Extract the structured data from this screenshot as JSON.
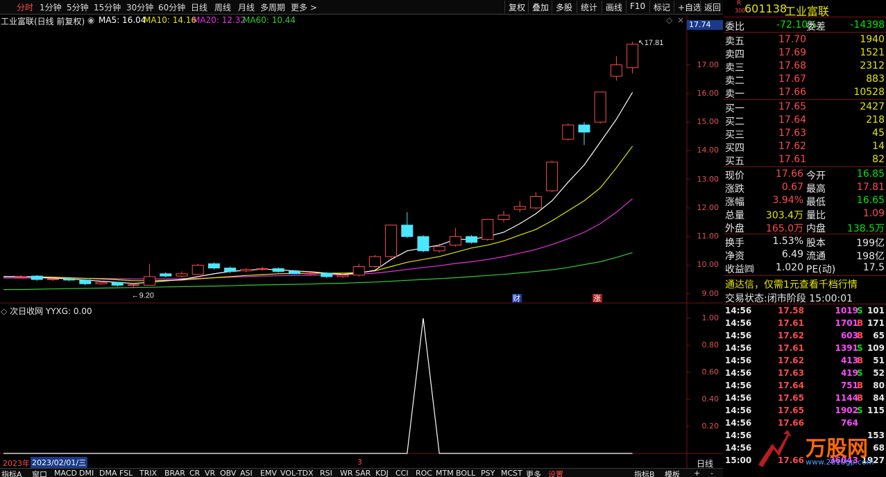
{
  "toolbar": {
    "periods": [
      "分时",
      "1分钟",
      "5分钟",
      "15分钟",
      "30分钟",
      "60分钟",
      "日线",
      "周线",
      "月线",
      "多周期",
      "更多 >"
    ],
    "active_period": "分时",
    "buttons": [
      "复权",
      "叠加",
      "多股",
      "统计",
      "画线",
      "F10",
      "标记",
      "+自选",
      "返回"
    ]
  },
  "chart_header": {
    "name": "工业富联(日线 前复权)",
    "ma5": "MA5: 16.04",
    "ma10": "MA10: 14.16",
    "ma20": "MA20: 12.32",
    "ma60": "MA60: 10.44"
  },
  "colors": {
    "up": "#ff4b4b",
    "down": "#4be6ff",
    "ma5": "#ffffff",
    "ma10": "#e6e600",
    "ma20": "#e633e6",
    "ma60": "#33cc33",
    "grid": "#7a1010"
  },
  "price_axis": {
    "current": "17.74",
    "ticks": [
      "17.00",
      "16.00",
      "15.00",
      "14.00",
      "13.00",
      "12.00",
      "11.00",
      "10.00",
      "9.00"
    ]
  },
  "chart_data": {
    "type": "candlestick",
    "ylim": [
      8.8,
      18.2
    ],
    "high_label": "17.81",
    "low_label": "9.20",
    "candles": [
      [
        9.58,
        9.6,
        9.65,
        9.55
      ],
      [
        9.62,
        9.5,
        9.65,
        9.45
      ],
      [
        9.5,
        9.52,
        9.55,
        9.45
      ],
      [
        9.52,
        9.48,
        9.56,
        9.44
      ],
      [
        9.48,
        9.35,
        9.5,
        9.3
      ],
      [
        9.35,
        9.4,
        9.45,
        9.32
      ],
      [
        9.4,
        9.3,
        9.42,
        9.25
      ],
      [
        9.3,
        9.32,
        9.36,
        9.2
      ],
      [
        9.3,
        9.6,
        10.05,
        9.3
      ],
      [
        9.7,
        9.62,
        9.75,
        9.58
      ],
      [
        9.62,
        9.7,
        9.78,
        9.58
      ],
      [
        9.68,
        10.0,
        10.05,
        9.66
      ],
      [
        10.05,
        9.9,
        10.1,
        9.85
      ],
      [
        9.9,
        9.78,
        9.95,
        9.72
      ],
      [
        9.8,
        9.85,
        9.9,
        9.75
      ],
      [
        9.86,
        9.88,
        9.95,
        9.8
      ],
      [
        9.88,
        9.78,
        9.92,
        9.74
      ],
      [
        9.78,
        9.7,
        9.82,
        9.68
      ],
      [
        9.7,
        9.72,
        9.75,
        9.66
      ],
      [
        9.72,
        9.6,
        9.75,
        9.55
      ],
      [
        9.6,
        9.65,
        9.7,
        9.56
      ],
      [
        9.65,
        9.95,
        10.05,
        9.6
      ],
      [
        9.95,
        10.3,
        10.35,
        9.9
      ],
      [
        10.3,
        11.4,
        11.4,
        10.25
      ],
      [
        11.4,
        11.0,
        11.85,
        10.95
      ],
      [
        11.0,
        10.5,
        11.05,
        10.45
      ],
      [
        10.5,
        10.65,
        10.75,
        10.45
      ],
      [
        10.7,
        11.0,
        11.3,
        10.65
      ],
      [
        11.0,
        10.8,
        11.05,
        10.75
      ],
      [
        10.9,
        11.6,
        11.6,
        10.85
      ],
      [
        11.6,
        11.75,
        11.9,
        11.5
      ],
      [
        11.95,
        12.05,
        12.25,
        11.85
      ],
      [
        12.0,
        12.4,
        12.55,
        11.95
      ],
      [
        12.6,
        13.6,
        13.65,
        12.55
      ],
      [
        14.4,
        14.9,
        14.95,
        14.35
      ],
      [
        14.9,
        14.65,
        15.0,
        14.2
      ],
      [
        15.0,
        16.05,
        16.05,
        14.95
      ],
      [
        16.6,
        17.0,
        17.3,
        16.45
      ],
      [
        16.9,
        17.72,
        17.81,
        16.7
      ]
    ],
    "ma5": [
      9.6,
      9.58,
      9.55,
      9.52,
      9.48,
      9.44,
      9.4,
      9.36,
      9.4,
      9.45,
      9.5,
      9.6,
      9.7,
      9.78,
      9.82,
      9.86,
      9.84,
      9.8,
      9.77,
      9.72,
      9.68,
      9.72,
      9.82,
      10.2,
      10.5,
      10.6,
      10.7,
      10.9,
      10.9,
      11.0,
      11.15,
      11.45,
      11.8,
      12.25,
      12.9,
      13.5,
      14.3,
      15.1,
      16.04
    ],
    "ma10": [
      9.6,
      9.59,
      9.58,
      9.56,
      9.54,
      9.52,
      9.49,
      9.46,
      9.46,
      9.47,
      9.48,
      9.52,
      9.56,
      9.6,
      9.64,
      9.67,
      9.7,
      9.71,
      9.72,
      9.72,
      9.72,
      9.74,
      9.8,
      9.95,
      10.1,
      10.2,
      10.3,
      10.45,
      10.6,
      10.7,
      10.85,
      11.05,
      11.25,
      11.55,
      11.9,
      12.25,
      12.7,
      13.4,
      14.16
    ],
    "ma20": [
      9.55,
      9.55,
      9.55,
      9.55,
      9.54,
      9.54,
      9.53,
      9.52,
      9.52,
      9.52,
      9.53,
      9.54,
      9.56,
      9.58,
      9.6,
      9.62,
      9.63,
      9.64,
      9.65,
      9.66,
      9.67,
      9.69,
      9.72,
      9.78,
      9.85,
      9.92,
      9.98,
      10.06,
      10.12,
      10.2,
      10.3,
      10.42,
      10.55,
      10.72,
      10.92,
      11.15,
      11.45,
      11.85,
      12.32
    ],
    "ma60": [
      9.15,
      9.16,
      9.17,
      9.18,
      9.19,
      9.2,
      9.21,
      9.22,
      9.23,
      9.24,
      9.25,
      9.26,
      9.27,
      9.28,
      9.3,
      9.31,
      9.32,
      9.33,
      9.34,
      9.36,
      9.37,
      9.39,
      9.41,
      9.44,
      9.47,
      9.5,
      9.53,
      9.56,
      9.6,
      9.64,
      9.68,
      9.73,
      9.78,
      9.84,
      9.92,
      10.02,
      10.12,
      10.27,
      10.44
    ],
    "markers": [
      "财",
      "涨"
    ]
  },
  "indicator": {
    "header": "次日收网  YYXG: 0.00",
    "ticks": [
      "1.00",
      "0.80",
      "0.60",
      "0.40",
      "0.20"
    ],
    "ylim": [
      0,
      1
    ],
    "values": [
      0,
      0,
      0,
      0,
      0,
      0,
      0,
      0,
      0,
      0,
      0,
      0,
      0,
      0,
      0,
      0,
      0,
      0,
      0,
      0,
      0,
      0,
      0,
      0,
      0,
      1,
      0,
      0,
      0,
      0,
      0,
      0,
      0,
      0,
      0,
      0,
      0,
      0,
      0
    ],
    "axis_year": "2023年",
    "axis_date": "2023/02/01/三",
    "axis_month": "3"
  },
  "bottom_tabs": [
    "指标A",
    "窗口",
    "MACD",
    "DMI",
    "DMA",
    "FSL",
    "TRIX",
    "BRAR",
    "CR",
    "VR",
    "OBV",
    "ASI",
    "EMV",
    "VOL-TDX",
    "RSI",
    "WR",
    "SAR",
    "KDJ",
    "CCI",
    "ROC",
    "MTM",
    "BOLL",
    "PSY",
    "MCST",
    "更多",
    "设置"
  ],
  "bottom_right": [
    "指标B",
    "模板",
    "+",
    "-"
  ],
  "period_label": "日线",
  "quote": {
    "market_tag": "R",
    "index_tag": "300",
    "code": "601138",
    "name": "工业富联",
    "wb_label": "委比",
    "wb_value": "-72.10%",
    "wc_label": "委差",
    "wc_value": "-14398",
    "asks": [
      {
        "label": "卖五",
        "price": "17.70",
        "vol": "1940"
      },
      {
        "label": "卖四",
        "price": "17.69",
        "vol": "1521"
      },
      {
        "label": "卖三",
        "price": "17.68",
        "vol": "2312"
      },
      {
        "label": "卖二",
        "price": "17.67",
        "vol": "883"
      },
      {
        "label": "卖一",
        "price": "17.66",
        "vol": "10528"
      }
    ],
    "bids": [
      {
        "label": "买一",
        "price": "17.65",
        "vol": "2427"
      },
      {
        "label": "买二",
        "price": "17.64",
        "vol": "218"
      },
      {
        "label": "买三",
        "price": "17.63",
        "vol": "45"
      },
      {
        "label": "买四",
        "price": "17.62",
        "vol": "14"
      },
      {
        "label": "买五",
        "price": "17.61",
        "vol": "82"
      }
    ],
    "stats": [
      {
        "l1": "现价",
        "v1": "17.66",
        "c1": "red",
        "l2": "今开",
        "v2": "16.85",
        "c2": "green"
      },
      {
        "l1": "涨跌",
        "v1": "0.67",
        "c1": "red",
        "l2": "最高",
        "v2": "17.81",
        "c2": "red"
      },
      {
        "l1": "涨幅",
        "v1": "3.94%",
        "c1": "red",
        "l2": "最低",
        "v2": "16.65",
        "c2": "green"
      },
      {
        "l1": "总量",
        "v1": "303.4万",
        "c1": "yellow",
        "l2": "量比",
        "v2": "1.09",
        "c2": "red"
      },
      {
        "l1": "外盘",
        "v1": "165.0万",
        "c1": "red",
        "l2": "内盘",
        "v2": "138.5万",
        "c2": "green"
      }
    ],
    "stats2": [
      {
        "l1": "换手",
        "v1": "1.53%",
        "l2": "股本",
        "v2": "199亿"
      },
      {
        "l1": "净资",
        "v1": "6.49",
        "l2": "流通",
        "v2": "198亿"
      },
      {
        "l1": "收益㈣",
        "v1": "1.020",
        "l2": "PE(动)",
        "v2": "17.5"
      }
    ],
    "ad_text": "通达信，仅需1元查看千档行情",
    "trade_status_label": "交易状态:",
    "trade_status_value": "闭市阶段 15:00:01"
  },
  "trades": [
    {
      "time": "14:56",
      "price": "17.58",
      "vol": "1019",
      "side": "S",
      "n": "101"
    },
    {
      "time": "14:56",
      "price": "17.61",
      "vol": "1701",
      "side": "B",
      "n": "171"
    },
    {
      "time": "14:56",
      "price": "17.62",
      "vol": "603",
      "side": "B",
      "n": "65"
    },
    {
      "time": "14:56",
      "price": "17.61",
      "vol": "1391",
      "side": "S",
      "n": "109"
    },
    {
      "time": "14:56",
      "price": "17.62",
      "vol": "413",
      "side": "B",
      "n": "51"
    },
    {
      "time": "14:56",
      "price": "17.63",
      "vol": "419",
      "side": "S",
      "n": "52"
    },
    {
      "time": "14:56",
      "price": "17.64",
      "vol": "751",
      "side": "B",
      "n": "80"
    },
    {
      "time": "14:56",
      "price": "17.65",
      "vol": "1144",
      "side": "B",
      "n": "84"
    },
    {
      "time": "14:56",
      "price": "17.65",
      "vol": "1902",
      "side": "S",
      "n": "115"
    },
    {
      "time": "14:56",
      "price": "17.66",
      "vol": "764",
      "side": "",
      "n": ""
    },
    {
      "time": "14:56",
      "price": "",
      "vol": "",
      "side": "",
      "n": "153"
    },
    {
      "time": "14:56",
      "price": "",
      "vol": "",
      "side": "",
      "n": "68"
    },
    {
      "time": "15:00",
      "price": "17.66",
      "vol": "36043",
      "side": "",
      "n": "1927"
    }
  ],
  "watermark": {
    "title": "万股网",
    "url": "www.2010gp.com"
  }
}
